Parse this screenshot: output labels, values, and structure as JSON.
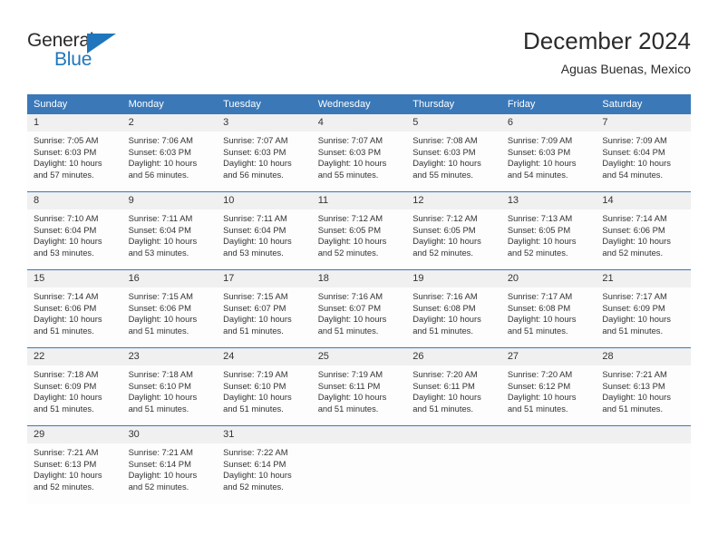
{
  "logo": {
    "word_one": "General",
    "word_two": "Blue",
    "triangle_icon": "blue-triangle-icon",
    "accent_color": "#1f76bc"
  },
  "header": {
    "title": "December 2024",
    "subtitle": "Aguas Buenas, Mexico"
  },
  "theme": {
    "header_blue": "#3a78b8",
    "day_band": "#f0f0f0",
    "text": "#333333"
  },
  "weekday_headers": [
    "Sunday",
    "Monday",
    "Tuesday",
    "Wednesday",
    "Thursday",
    "Friday",
    "Saturday"
  ],
  "labels": {
    "sunrise_prefix": "Sunrise:",
    "sunset_prefix": "Sunset:",
    "daylight_prefix": "Daylight:"
  },
  "weeks": [
    [
      {
        "day": "1",
        "sunrise": "Sunrise: 7:05 AM",
        "sunset": "Sunset: 6:03 PM",
        "daylight": "Daylight: 10 hours and 57 minutes."
      },
      {
        "day": "2",
        "sunrise": "Sunrise: 7:06 AM",
        "sunset": "Sunset: 6:03 PM",
        "daylight": "Daylight: 10 hours and 56 minutes."
      },
      {
        "day": "3",
        "sunrise": "Sunrise: 7:07 AM",
        "sunset": "Sunset: 6:03 PM",
        "daylight": "Daylight: 10 hours and 56 minutes."
      },
      {
        "day": "4",
        "sunrise": "Sunrise: 7:07 AM",
        "sunset": "Sunset: 6:03 PM",
        "daylight": "Daylight: 10 hours and 55 minutes."
      },
      {
        "day": "5",
        "sunrise": "Sunrise: 7:08 AM",
        "sunset": "Sunset: 6:03 PM",
        "daylight": "Daylight: 10 hours and 55 minutes."
      },
      {
        "day": "6",
        "sunrise": "Sunrise: 7:09 AM",
        "sunset": "Sunset: 6:03 PM",
        "daylight": "Daylight: 10 hours and 54 minutes."
      },
      {
        "day": "7",
        "sunrise": "Sunrise: 7:09 AM",
        "sunset": "Sunset: 6:04 PM",
        "daylight": "Daylight: 10 hours and 54 minutes."
      }
    ],
    [
      {
        "day": "8",
        "sunrise": "Sunrise: 7:10 AM",
        "sunset": "Sunset: 6:04 PM",
        "daylight": "Daylight: 10 hours and 53 minutes."
      },
      {
        "day": "9",
        "sunrise": "Sunrise: 7:11 AM",
        "sunset": "Sunset: 6:04 PM",
        "daylight": "Daylight: 10 hours and 53 minutes."
      },
      {
        "day": "10",
        "sunrise": "Sunrise: 7:11 AM",
        "sunset": "Sunset: 6:04 PM",
        "daylight": "Daylight: 10 hours and 53 minutes."
      },
      {
        "day": "11",
        "sunrise": "Sunrise: 7:12 AM",
        "sunset": "Sunset: 6:05 PM",
        "daylight": "Daylight: 10 hours and 52 minutes."
      },
      {
        "day": "12",
        "sunrise": "Sunrise: 7:12 AM",
        "sunset": "Sunset: 6:05 PM",
        "daylight": "Daylight: 10 hours and 52 minutes."
      },
      {
        "day": "13",
        "sunrise": "Sunrise: 7:13 AM",
        "sunset": "Sunset: 6:05 PM",
        "daylight": "Daylight: 10 hours and 52 minutes."
      },
      {
        "day": "14",
        "sunrise": "Sunrise: 7:14 AM",
        "sunset": "Sunset: 6:06 PM",
        "daylight": "Daylight: 10 hours and 52 minutes."
      }
    ],
    [
      {
        "day": "15",
        "sunrise": "Sunrise: 7:14 AM",
        "sunset": "Sunset: 6:06 PM",
        "daylight": "Daylight: 10 hours and 51 minutes."
      },
      {
        "day": "16",
        "sunrise": "Sunrise: 7:15 AM",
        "sunset": "Sunset: 6:06 PM",
        "daylight": "Daylight: 10 hours and 51 minutes."
      },
      {
        "day": "17",
        "sunrise": "Sunrise: 7:15 AM",
        "sunset": "Sunset: 6:07 PM",
        "daylight": "Daylight: 10 hours and 51 minutes."
      },
      {
        "day": "18",
        "sunrise": "Sunrise: 7:16 AM",
        "sunset": "Sunset: 6:07 PM",
        "daylight": "Daylight: 10 hours and 51 minutes."
      },
      {
        "day": "19",
        "sunrise": "Sunrise: 7:16 AM",
        "sunset": "Sunset: 6:08 PM",
        "daylight": "Daylight: 10 hours and 51 minutes."
      },
      {
        "day": "20",
        "sunrise": "Sunrise: 7:17 AM",
        "sunset": "Sunset: 6:08 PM",
        "daylight": "Daylight: 10 hours and 51 minutes."
      },
      {
        "day": "21",
        "sunrise": "Sunrise: 7:17 AM",
        "sunset": "Sunset: 6:09 PM",
        "daylight": "Daylight: 10 hours and 51 minutes."
      }
    ],
    [
      {
        "day": "22",
        "sunrise": "Sunrise: 7:18 AM",
        "sunset": "Sunset: 6:09 PM",
        "daylight": "Daylight: 10 hours and 51 minutes."
      },
      {
        "day": "23",
        "sunrise": "Sunrise: 7:18 AM",
        "sunset": "Sunset: 6:10 PM",
        "daylight": "Daylight: 10 hours and 51 minutes."
      },
      {
        "day": "24",
        "sunrise": "Sunrise: 7:19 AM",
        "sunset": "Sunset: 6:10 PM",
        "daylight": "Daylight: 10 hours and 51 minutes."
      },
      {
        "day": "25",
        "sunrise": "Sunrise: 7:19 AM",
        "sunset": "Sunset: 6:11 PM",
        "daylight": "Daylight: 10 hours and 51 minutes."
      },
      {
        "day": "26",
        "sunrise": "Sunrise: 7:20 AM",
        "sunset": "Sunset: 6:11 PM",
        "daylight": "Daylight: 10 hours and 51 minutes."
      },
      {
        "day": "27",
        "sunrise": "Sunrise: 7:20 AM",
        "sunset": "Sunset: 6:12 PM",
        "daylight": "Daylight: 10 hours and 51 minutes."
      },
      {
        "day": "28",
        "sunrise": "Sunrise: 7:21 AM",
        "sunset": "Sunset: 6:13 PM",
        "daylight": "Daylight: 10 hours and 51 minutes."
      }
    ],
    [
      {
        "day": "29",
        "sunrise": "Sunrise: 7:21 AM",
        "sunset": "Sunset: 6:13 PM",
        "daylight": "Daylight: 10 hours and 52 minutes."
      },
      {
        "day": "30",
        "sunrise": "Sunrise: 7:21 AM",
        "sunset": "Sunset: 6:14 PM",
        "daylight": "Daylight: 10 hours and 52 minutes."
      },
      {
        "day": "31",
        "sunrise": "Sunrise: 7:22 AM",
        "sunset": "Sunset: 6:14 PM",
        "daylight": "Daylight: 10 hours and 52 minutes."
      },
      {
        "day": "",
        "sunrise": "",
        "sunset": "",
        "daylight": ""
      },
      {
        "day": "",
        "sunrise": "",
        "sunset": "",
        "daylight": ""
      },
      {
        "day": "",
        "sunrise": "",
        "sunset": "",
        "daylight": ""
      },
      {
        "day": "",
        "sunrise": "",
        "sunset": "",
        "daylight": ""
      }
    ]
  ]
}
